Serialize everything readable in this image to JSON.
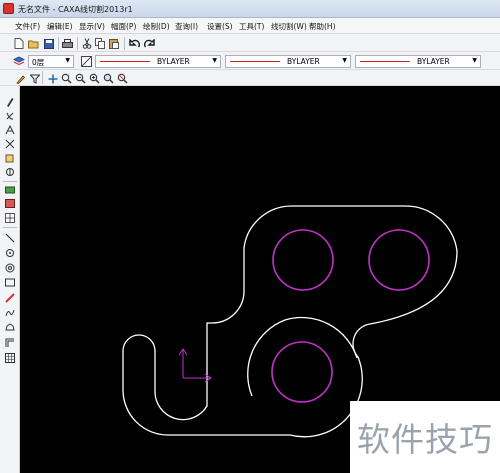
{
  "window": {
    "title": "无名文件 - CAXA线切割2013r1"
  },
  "menu": [
    "文件(F)",
    "编辑(E)",
    "显示(V)",
    "幅面(P)",
    "绘制(D)",
    "查询(I)",
    "设置(S)",
    "工具(T)",
    "线切割(W)",
    "帮助(H)"
  ],
  "properties": {
    "layer": "0层",
    "linetype": "BYLAYER",
    "lineweight": "BYLAYER",
    "color": "BYLAYER"
  },
  "watermark": {
    "text": "软件技巧"
  },
  "colors": {
    "canvas": "#000000",
    "outline": "#ffffff",
    "circles": "#c132c8",
    "ucs": "#c132c8",
    "accent_red": "#d21f1f"
  },
  "icons": {
    "toolbar1": [
      "new-icon",
      "open-icon",
      "save-icon",
      "print-icon",
      "cut-icon",
      "copy-icon",
      "paste-icon",
      "undo-icon",
      "redo-icon"
    ],
    "toolbar3": [
      "pen-icon",
      "filter-icon",
      "pan-icon",
      "zoom-window-icon",
      "zoom-realtime-icon",
      "zoom-in-icon",
      "zoom-extents-icon"
    ],
    "left_tools": [
      "pencil-icon",
      "modify-icon",
      "text-icon",
      "trim-icon",
      "block-icon",
      "library-icon",
      "camera-icon",
      "image-icon",
      "grid-icon",
      "line-icon",
      "point-icon",
      "circle-icon",
      "rect-icon",
      "hatch-icon",
      "spline-icon",
      "cloud-icon",
      "offset-icon",
      "table-icon"
    ]
  }
}
